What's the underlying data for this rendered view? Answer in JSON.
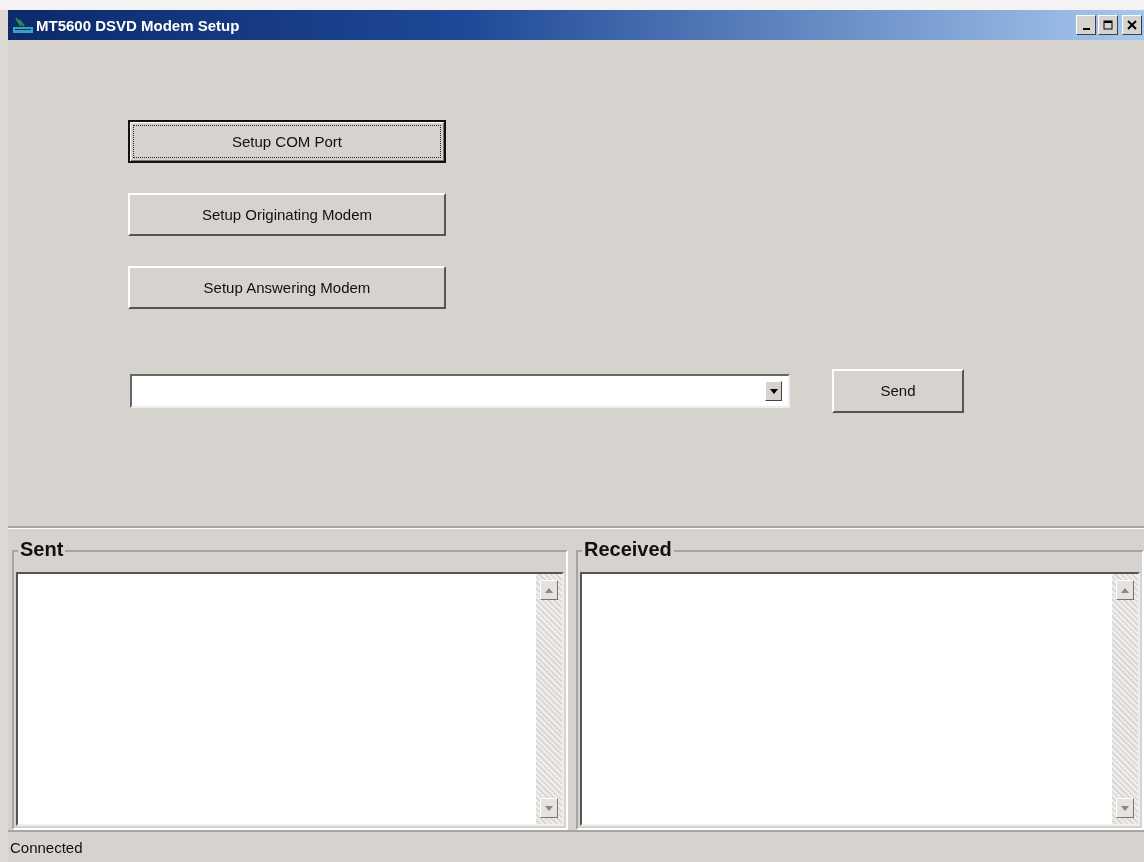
{
  "window": {
    "title": "MT5600 DSVD Modem Setup",
    "controls": [
      {
        "kind": "minimize"
      },
      {
        "kind": "maximize"
      },
      {
        "kind": "close"
      }
    ]
  },
  "setup_buttons": [
    {
      "label": "Setup COM Port",
      "focused": true
    },
    {
      "label": "Setup Originating Modem",
      "focused": false
    },
    {
      "label": "Setup Answering Modem",
      "focused": false
    }
  ],
  "send_button": {
    "label": "Send"
  },
  "panels": [
    {
      "title": "Sent"
    },
    {
      "title": "Received"
    }
  ],
  "status_bar": {
    "text": "Connected"
  }
}
